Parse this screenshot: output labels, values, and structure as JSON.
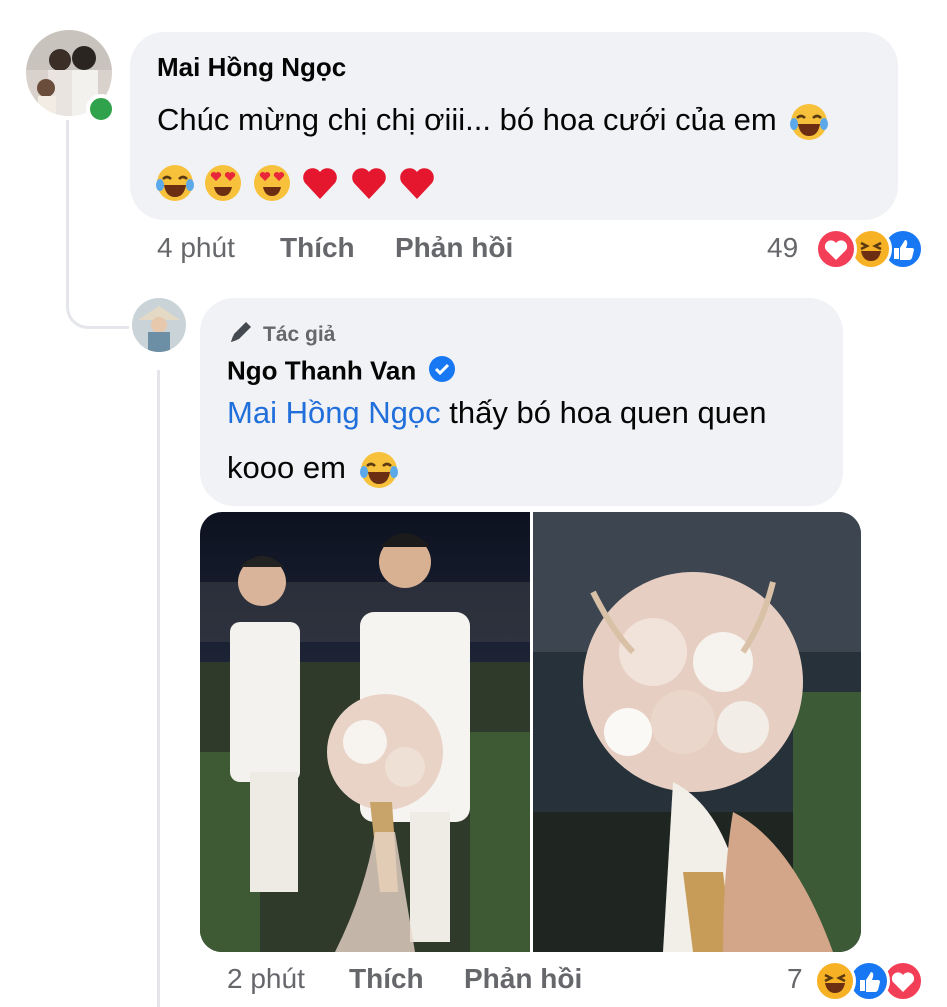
{
  "comment1": {
    "author": "Mai Hồng Ngọc",
    "text": "Chúc mừng chị chị ơiii... bó hoa cưới của em",
    "time": "4 phút",
    "like_label": "Thích",
    "reply_label": "Phản hồi",
    "reaction_count": "49",
    "emojis": [
      "joy-emoji",
      "heart-eyes-emoji",
      "heart-eyes-emoji",
      "red-heart",
      "red-heart",
      "red-heart"
    ]
  },
  "reply1": {
    "badge": "Tác giả",
    "author": "Ngo Thanh Van",
    "mention": "Mai Hồng Ngọc",
    "text_line1": " thấy bó hoa quen quen",
    "text_line2": "kooo em",
    "time": "2 phút",
    "like_label": "Thích",
    "reply_label": "Phản hồi",
    "reaction_count": "7"
  },
  "colors": {
    "bubble": "#f0f2f5",
    "mention": "#216fdb",
    "meta": "#65676b",
    "online": "#31a24c",
    "like_blue": "#1877f2",
    "love_red": "#f33e58",
    "haha_yellow": "#f7b125"
  }
}
